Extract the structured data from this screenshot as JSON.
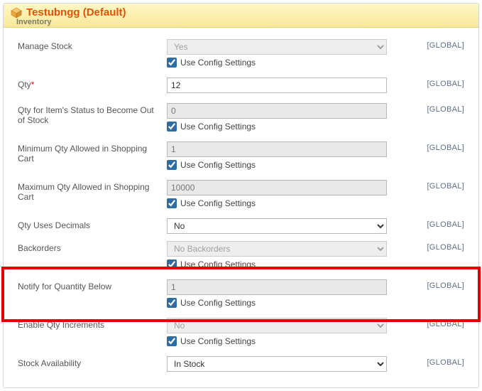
{
  "header": {
    "title": "Testubngg (Default)",
    "sub": "Inventory"
  },
  "scope_label": "[GLOBAL]",
  "use_config_label": "Use Config Settings",
  "fields": {
    "manage_stock": {
      "label": "Manage Stock",
      "value": "Yes",
      "use_config": true
    },
    "qty": {
      "label": "Qty",
      "value": "12",
      "required": true
    },
    "qty_out_of_stock": {
      "label": "Qty for Item's Status to Become Out of Stock",
      "value": "0",
      "use_config": true
    },
    "min_qty_cart": {
      "label": "Minimum Qty Allowed in Shopping Cart",
      "value": "1",
      "use_config": true
    },
    "max_qty_cart": {
      "label": "Maximum Qty Allowed in Shopping Cart",
      "value": "10000",
      "use_config": true
    },
    "qty_decimals": {
      "label": "Qty Uses Decimals",
      "value": "No"
    },
    "backorders": {
      "label": "Backorders",
      "value": "No Backorders",
      "use_config": true
    },
    "notify_below": {
      "label": "Notify for Quantity Below",
      "value": "1",
      "use_config": true
    },
    "enable_qty_incr": {
      "label": "Enable Qty Increments",
      "value": "No",
      "use_config": true
    },
    "stock_avail": {
      "label": "Stock Availability",
      "value": "In Stock"
    }
  }
}
